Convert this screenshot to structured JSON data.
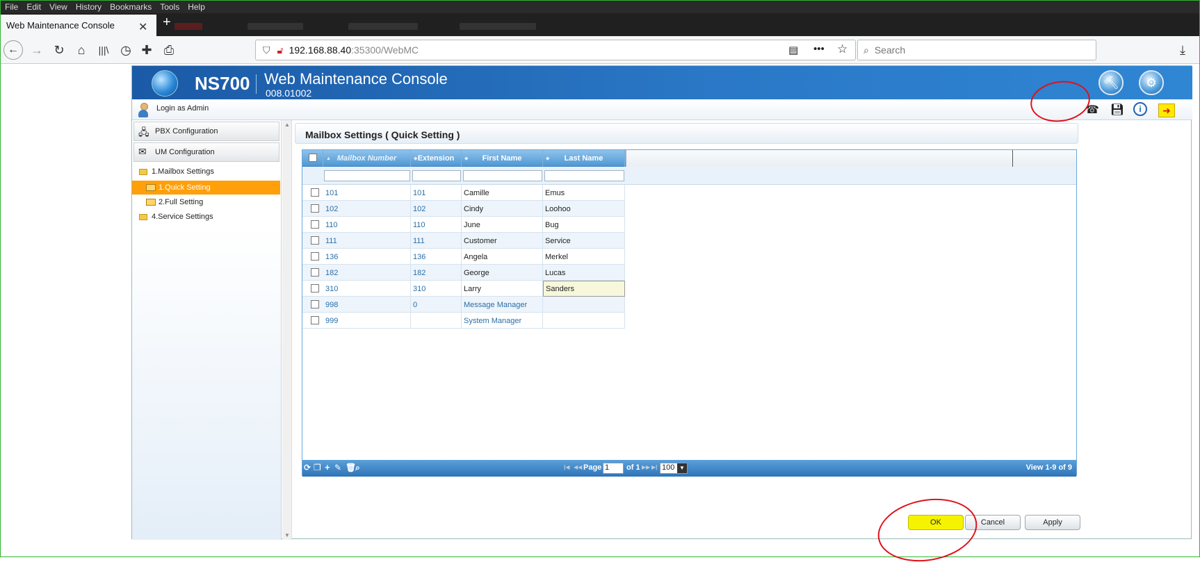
{
  "browser": {
    "menu": [
      "File",
      "Edit",
      "View",
      "History",
      "Bookmarks",
      "Tools",
      "Help"
    ],
    "tab_title": "Web Maintenance Console",
    "url_host": "192.168.88.40",
    "url_rest": ":35300/WebMC",
    "search_placeholder": "Search"
  },
  "app": {
    "model": "NS700",
    "title": "Web Maintenance Console",
    "version": "008.01002",
    "login_label": "Login as Admin"
  },
  "sidebar": {
    "pbx": "PBX Configuration",
    "um": "UM Configuration",
    "tree": [
      {
        "label": "1.Mailbox Settings"
      },
      {
        "label": "1.Quick Setting"
      },
      {
        "label": "2.Full Setting"
      },
      {
        "label": "4.Service Settings"
      }
    ]
  },
  "page": {
    "title": "Mailbox Settings ( Quick Setting )"
  },
  "grid": {
    "columns": [
      "Mailbox Number",
      "Extension",
      "First Name",
      "Last Name"
    ],
    "rows": [
      {
        "mailbox": "101",
        "ext": "101",
        "first": "Camille",
        "last": "Emus"
      },
      {
        "mailbox": "102",
        "ext": "102",
        "first": "Cindy",
        "last": "Loohoo"
      },
      {
        "mailbox": "110",
        "ext": "110",
        "first": "June",
        "last": "Bug"
      },
      {
        "mailbox": "111",
        "ext": "111",
        "first": "Customer",
        "last": "Service"
      },
      {
        "mailbox": "136",
        "ext": "136",
        "first": "Angela",
        "last": "Merkel"
      },
      {
        "mailbox": "182",
        "ext": "182",
        "first": "George",
        "last": "Lucas"
      },
      {
        "mailbox": "310",
        "ext": "310",
        "first": "Larry",
        "last": "Sanders"
      },
      {
        "mailbox": "998",
        "ext": "0",
        "first": "Message Manager",
        "last": ""
      },
      {
        "mailbox": "999",
        "ext": "",
        "first": "System Manager",
        "last": ""
      }
    ],
    "pager": {
      "page_label": "Page",
      "page_value": "1",
      "of_label": "of 1",
      "per_page": "100",
      "view": "View 1-9 of 9"
    }
  },
  "buttons": {
    "ok": "OK",
    "cancel": "Cancel",
    "apply": "Apply"
  },
  "colors": {
    "accent": "#2a78c7",
    "highlight": "#f5f300",
    "selection": "#ff9f0a",
    "annotation": "#e0111b"
  }
}
